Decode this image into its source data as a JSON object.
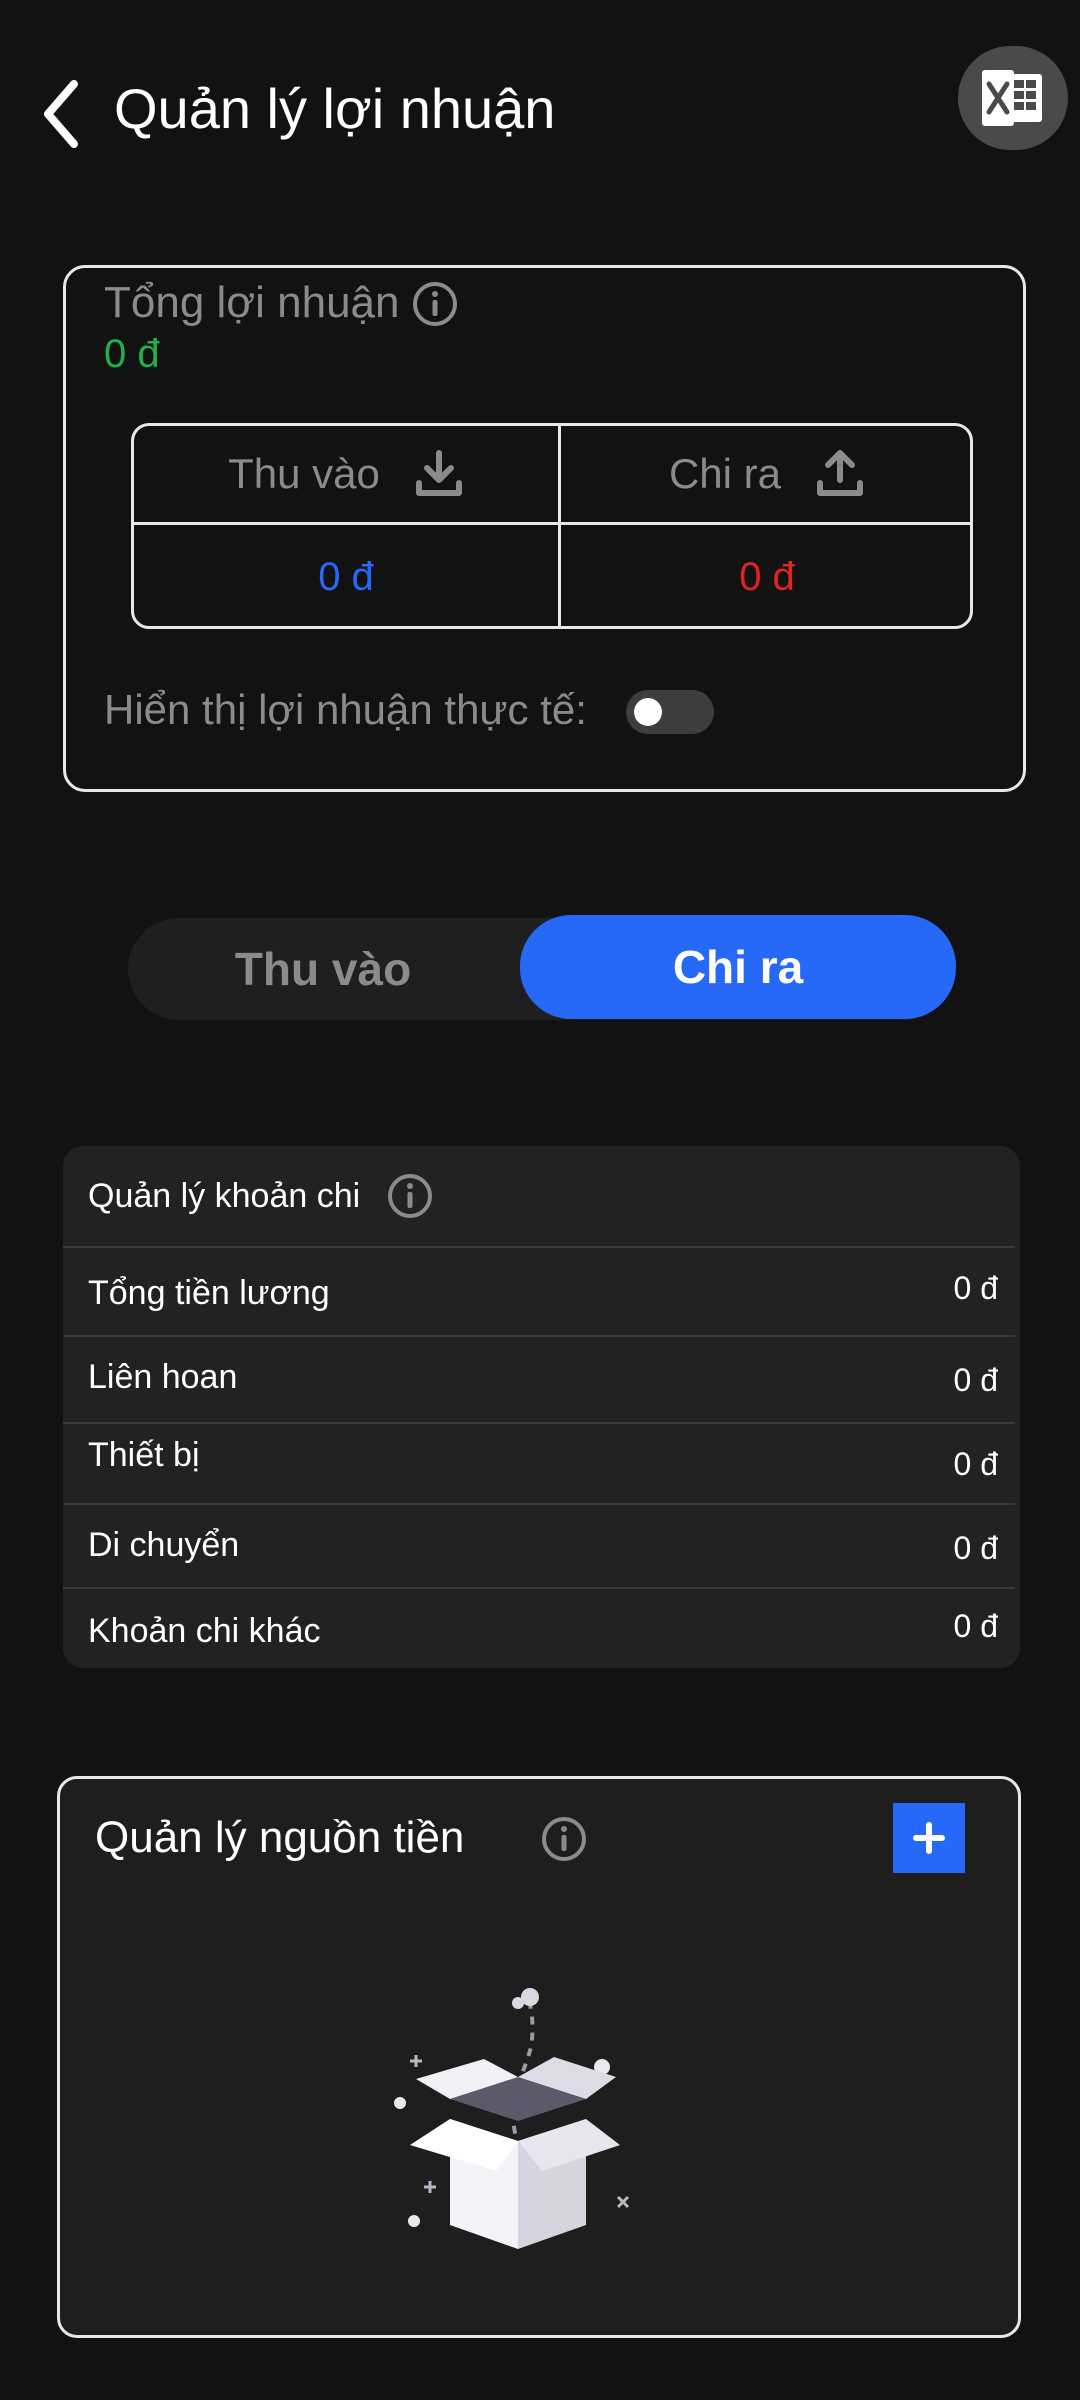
{
  "header": {
    "title": "Quản lý lợi nhuận",
    "back_icon": "chevron-left-icon",
    "export_icon": "excel-icon"
  },
  "summary": {
    "label": "Tổng lợi nhuận",
    "value": "0 đ",
    "value_color": "#22b04b",
    "income": {
      "label": "Thu vào",
      "value": "0 đ",
      "color": "#2668f7",
      "icon": "download-icon"
    },
    "expense": {
      "label": "Chi ra",
      "value": "0 đ",
      "color": "#e02424",
      "icon": "upload-icon"
    },
    "actual_profit_label": "Hiển thị lợi nhuận thực tế:",
    "actual_profit_toggle_on": false
  },
  "tabs": {
    "items": [
      "Thu vào",
      "Chi ra"
    ],
    "selected": "Chi ra",
    "accent": "#2668f7"
  },
  "expense_management": {
    "title": "Quản lý khoản chi",
    "rows": [
      {
        "label": "Tổng tiền lương",
        "value": "0 đ"
      },
      {
        "label": "Liên hoan",
        "value": "0 đ"
      },
      {
        "label": "Thiết bị",
        "value": "0 đ"
      },
      {
        "label": "Di chuyển",
        "value": "0 đ"
      },
      {
        "label": "Khoản chi khác",
        "value": "0 đ"
      }
    ]
  },
  "money_sources": {
    "title": "Quản lý nguồn tiền",
    "add_icon": "plus-icon",
    "empty_illustration": "empty-box-illustration"
  }
}
